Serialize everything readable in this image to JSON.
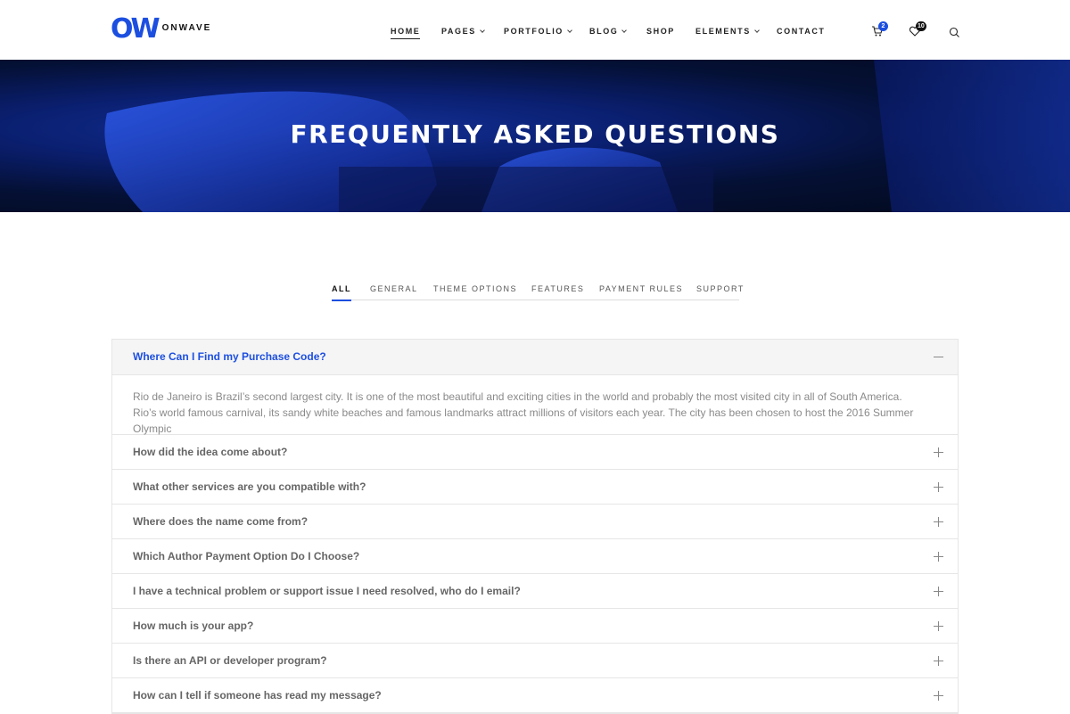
{
  "brand": {
    "mark": "OW",
    "name": "ONWAVE",
    "accent": "#1c4fe0"
  },
  "nav": {
    "items": [
      {
        "label": "HOME",
        "active": true,
        "dropdown": false
      },
      {
        "label": "PAGES",
        "active": false,
        "dropdown": true
      },
      {
        "label": "PORTFOLIO",
        "active": false,
        "dropdown": true
      },
      {
        "label": "BLOG",
        "active": false,
        "dropdown": true
      },
      {
        "label": "SHOP",
        "active": false,
        "dropdown": false
      },
      {
        "label": "ELEMENTS",
        "active": false,
        "dropdown": true
      },
      {
        "label": "CONTACT",
        "active": false,
        "dropdown": false
      }
    ],
    "cart_count": "2",
    "wishlist_count": "10",
    "icons": [
      "cart-icon",
      "heart-icon",
      "search-icon"
    ]
  },
  "hero": {
    "title": "FREQUENTLY ASKED QUESTIONS"
  },
  "tabs": [
    {
      "label": "ALL",
      "active": true
    },
    {
      "label": "GENERAL",
      "active": false
    },
    {
      "label": "THEME OPTIONS",
      "active": false
    },
    {
      "label": "FEATURES",
      "active": false
    },
    {
      "label": "PAYMENT RULES",
      "active": false
    },
    {
      "label": "SUPPORT",
      "active": false
    }
  ],
  "faq": {
    "open": {
      "question": "Where Can I Find my Purchase Code?",
      "answer": "Rio de Janeiro is Brazil’s second largest city. It is one of the most beautiful and exciting cities in the world and probably the most visited city in all of South America. Rio’s world famous carnival, its sandy white beaches and famous landmarks attract millions of visitors each year. The city has been chosen to host the 2016 Summer Olympic"
    },
    "items": [
      "How did the idea come about?",
      "What other services are you compatible with?",
      "Where does the name come from?",
      "Which Author Payment Option Do I Choose?",
      "I have a technical problem or support issue I need resolved, who do I email?",
      "How much is your app?",
      "Is there an API or developer program?",
      "How can I tell if someone has read my message?"
    ]
  }
}
